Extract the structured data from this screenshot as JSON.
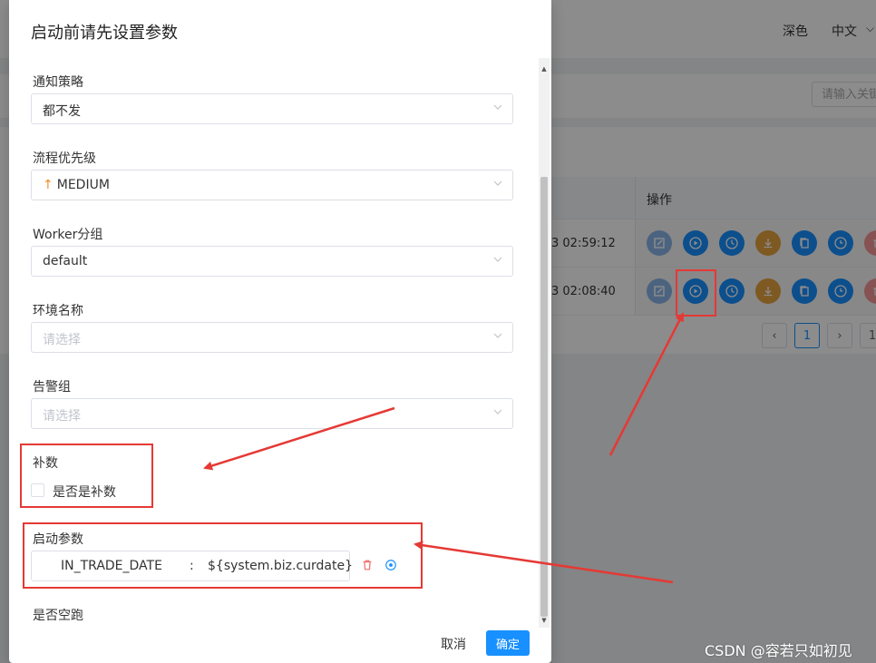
{
  "background": {
    "theme_label": "深色",
    "lang_label": "中文",
    "search_placeholder": "请输入关键",
    "ops_header": "操作",
    "rows": [
      {
        "time": "3 02:59:12"
      },
      {
        "time": "3 02:08:40"
      }
    ],
    "pagination": {
      "current": "1",
      "next_page": "1"
    }
  },
  "modal": {
    "title": "启动前请先设置参数",
    "fields": {
      "notify_strategy": {
        "label": "通知策略",
        "value": "都不发"
      },
      "priority": {
        "label": "流程优先级",
        "value": "MEDIUM",
        "arrow": "↑"
      },
      "worker_group": {
        "label": "Worker分组",
        "value": "default"
      },
      "env_name": {
        "label": "环境名称",
        "placeholder": "请选择"
      },
      "alert_group": {
        "label": "告警组",
        "placeholder": "请选择"
      },
      "complement": {
        "label": "补数",
        "checkbox_label": "是否是补数"
      },
      "startup_params": {
        "label": "启动参数",
        "key": "IN_TRADE_DATE",
        "separator": ":",
        "value": "${system.biz.curdate}"
      },
      "dry_run": {
        "label": "是否空跑"
      }
    },
    "cancel_label": "取消",
    "ok_label": "确定"
  },
  "watermark": "CSDN @容若只如初见",
  "colors": {
    "primary": "#1890ff",
    "warning": "#e6a23c",
    "danger": "#f56c6c",
    "annotation_red": "#e53935",
    "priority_arrow": "#f08c28"
  }
}
